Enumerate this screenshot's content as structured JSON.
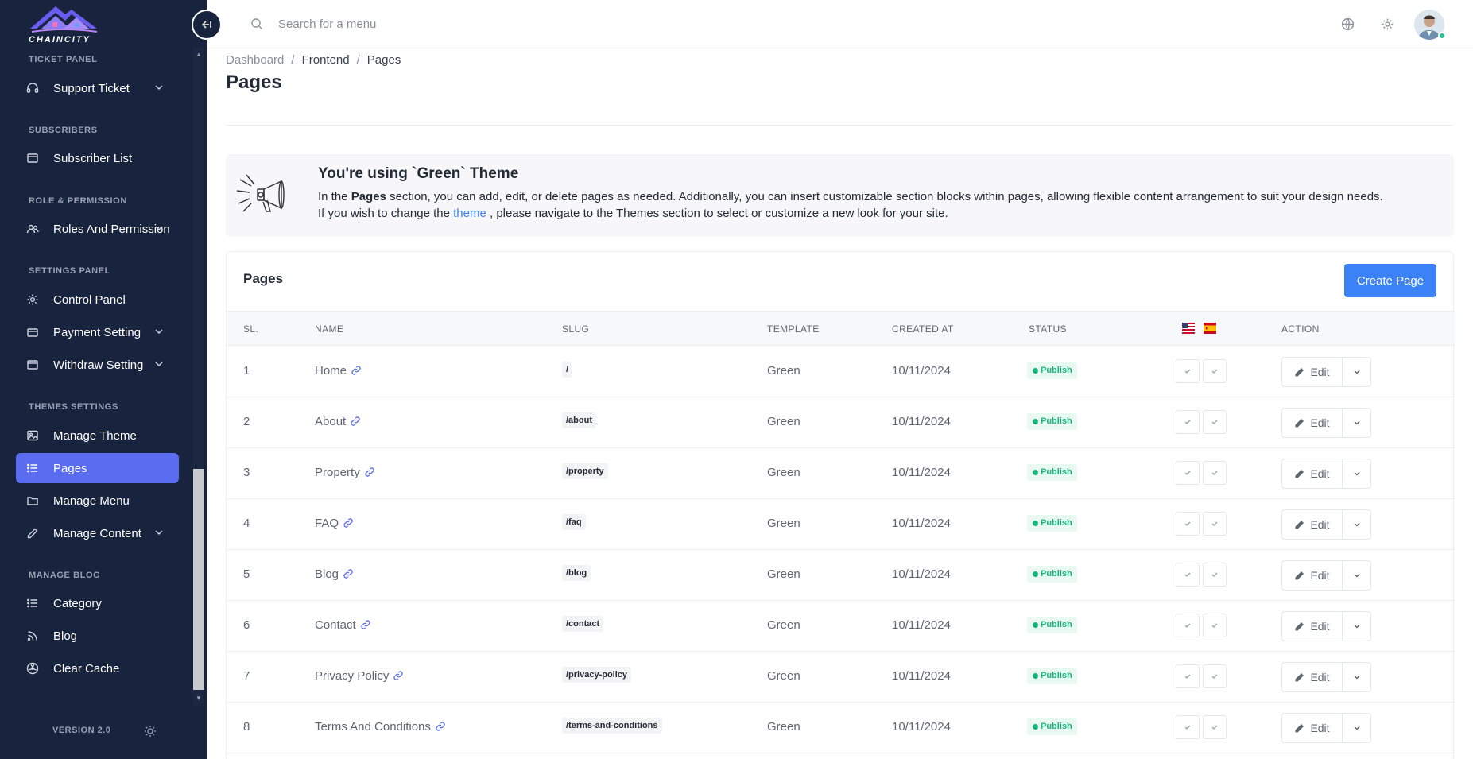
{
  "app": {
    "logo_text": "CHAINCITY",
    "version_label": "VERSION 2.0"
  },
  "sidebar": {
    "sections": [
      {
        "title": "TICKET PANEL",
        "items": [
          {
            "label": "Support Ticket",
            "icon": "headset-icon",
            "has_children": true
          }
        ]
      },
      {
        "title": "SUBSCRIBERS",
        "items": [
          {
            "label": "Subscriber List",
            "icon": "inbox-icon",
            "has_children": false
          }
        ]
      },
      {
        "title": "ROLE & PERMISSION",
        "items": [
          {
            "label": "Roles And Permission",
            "icon": "users-icon",
            "has_children": true
          }
        ]
      },
      {
        "title": "SETTINGS PANEL",
        "items": [
          {
            "label": "Control Panel",
            "icon": "gear-icon",
            "has_children": false
          },
          {
            "label": "Payment Setting",
            "icon": "wallet-icon",
            "has_children": true
          },
          {
            "label": "Withdraw Setting",
            "icon": "inbox-icon",
            "has_children": true
          }
        ]
      },
      {
        "title": "THEMES SETTINGS",
        "items": [
          {
            "label": "Manage Theme",
            "icon": "image-icon",
            "has_children": false
          },
          {
            "label": "Pages",
            "icon": "list-icon",
            "has_children": false,
            "active": true
          },
          {
            "label": "Manage Menu",
            "icon": "folder-icon",
            "has_children": false
          },
          {
            "label": "Manage Content",
            "icon": "pencil-icon",
            "has_children": true
          }
        ]
      },
      {
        "title": "MANAGE BLOG",
        "items": [
          {
            "label": "Category",
            "icon": "list-icon",
            "has_children": false
          },
          {
            "label": "Blog",
            "icon": "rss-icon",
            "has_children": false
          },
          {
            "label": "Clear Cache",
            "icon": "radiation-icon",
            "has_children": false
          }
        ]
      }
    ]
  },
  "topbar": {
    "search_placeholder": "Search for a menu"
  },
  "breadcrumb": [
    "Dashboard",
    "Frontend",
    "Pages"
  ],
  "page_title": "Pages",
  "notice": {
    "title": "You're using `Green` Theme",
    "line1_prefix": "In the ",
    "line1_bold": "Pages",
    "line1_suffix": " section, you can add, edit, or delete pages as needed. Additionally, you can insert customizable section blocks within pages, allowing flexible content arrangement to suit your design needs.",
    "line2_prefix": "If you wish to change the ",
    "line2_link": "theme",
    "line2_suffix": " , please navigate to the Themes section to select or customize a new look for your site."
  },
  "table": {
    "card_title": "Pages",
    "create_label": "Create Page",
    "headers": {
      "sl": "SL.",
      "name": "NAME",
      "slug": "SLUG",
      "template": "TEMPLATE",
      "created": "CREATED AT",
      "status": "STATUS",
      "action": "ACTION"
    },
    "edit_label": "Edit",
    "rows": [
      {
        "sl": "1",
        "name": "Home",
        "slug": "/",
        "template": "Green",
        "created": "10/11/2024",
        "status": "Publish"
      },
      {
        "sl": "2",
        "name": "About",
        "slug": "/about",
        "template": "Green",
        "created": "10/11/2024",
        "status": "Publish"
      },
      {
        "sl": "3",
        "name": "Property",
        "slug": "/property",
        "template": "Green",
        "created": "10/11/2024",
        "status": "Publish"
      },
      {
        "sl": "4",
        "name": "FAQ",
        "slug": "/faq",
        "template": "Green",
        "created": "10/11/2024",
        "status": "Publish"
      },
      {
        "sl": "5",
        "name": "Blog",
        "slug": "/blog",
        "template": "Green",
        "created": "10/11/2024",
        "status": "Publish"
      },
      {
        "sl": "6",
        "name": "Contact",
        "slug": "/contact",
        "template": "Green",
        "created": "10/11/2024",
        "status": "Publish"
      },
      {
        "sl": "7",
        "name": "Privacy Policy",
        "slug": "/privacy-policy",
        "template": "Green",
        "created": "10/11/2024",
        "status": "Publish"
      },
      {
        "sl": "8",
        "name": "Terms And Conditions",
        "slug": "/terms-and-conditions",
        "template": "Green",
        "created": "10/11/2024",
        "status": "Publish"
      }
    ]
  },
  "colors": {
    "sidebar_bg": "#18233e",
    "active_item": "#5a6cf0",
    "primary": "#3b82f6",
    "publish": "#17b37a"
  }
}
